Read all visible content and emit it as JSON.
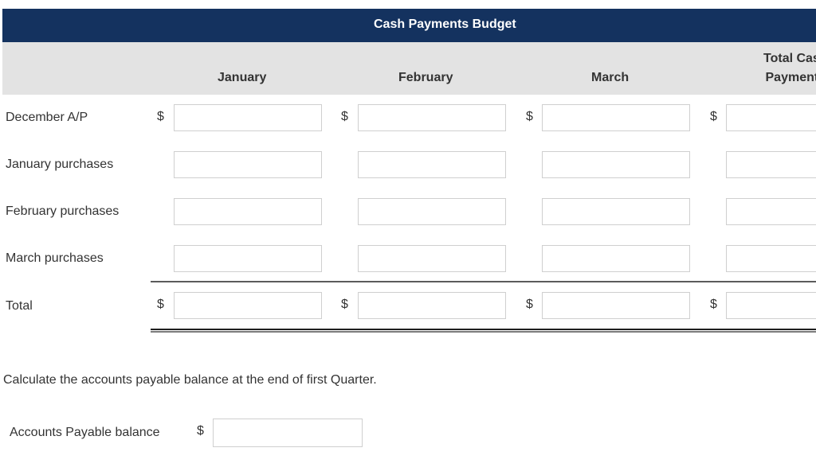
{
  "budget": {
    "title": "Cash Payments Budget",
    "columns": [
      {
        "label": "January"
      },
      {
        "label": "February"
      },
      {
        "label": "March"
      },
      {
        "label_line1": "Total Cash",
        "label_line2": "Payments"
      }
    ],
    "currency_symbol": "$",
    "rows": [
      {
        "label": "December A/P",
        "values": [
          "",
          "",
          "",
          ""
        ],
        "show_dollar": true
      },
      {
        "label": "January purchases",
        "values": [
          "",
          "",
          "",
          ""
        ],
        "show_dollar": false
      },
      {
        "label": "February purchases",
        "values": [
          "",
          "",
          "",
          ""
        ],
        "show_dollar": false
      },
      {
        "label": "March purchases",
        "values": [
          "",
          "",
          "",
          ""
        ],
        "show_dollar": false
      },
      {
        "label": "Total",
        "values": [
          "",
          "",
          "",
          ""
        ],
        "show_dollar": true
      }
    ]
  },
  "question": {
    "text": "Calculate the accounts payable balance at the end of first Quarter.",
    "field_label": "Accounts Payable balance",
    "currency_symbol": "$",
    "value": ""
  }
}
